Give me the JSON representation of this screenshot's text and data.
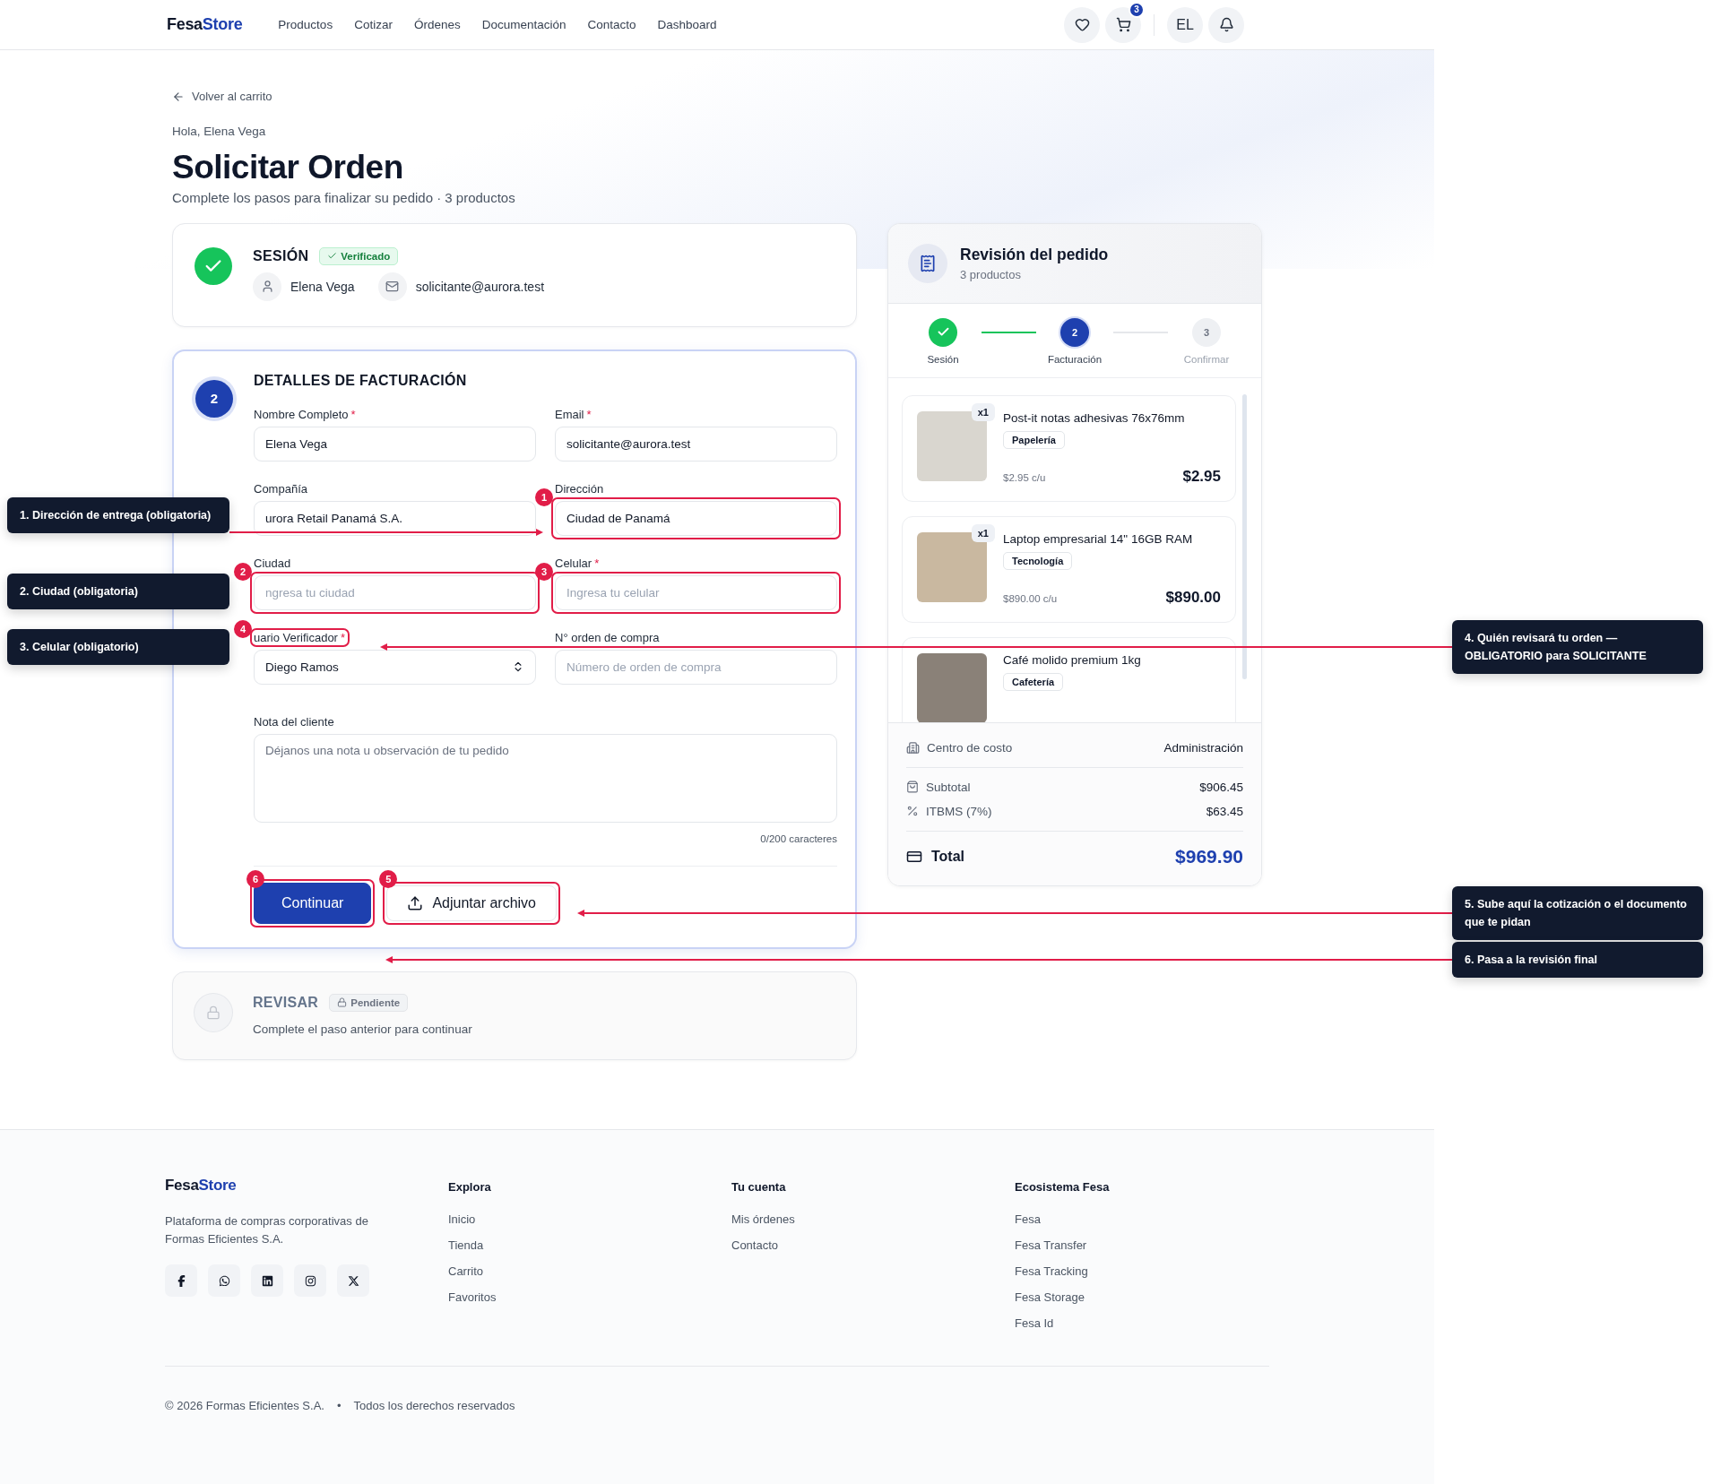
{
  "header": {
    "logo": {
      "part_1": "Fesa",
      "part_2": "Store"
    },
    "nav": [
      "Productos",
      "Cotizar",
      "Órdenes",
      "Documentación",
      "Contacto",
      "Dashboard"
    ],
    "cart_count": "3",
    "avatar": "EL"
  },
  "back_link": "Volver al carrito",
  "greeting": "Hola, Elena Vega",
  "title": "Solicitar Orden",
  "subtitle": "Complete los pasos para finalizar su pedido · 3 productos",
  "steps": [
    {
      "kind": "done",
      "title": "SESIÓN",
      "badge": "Verificado",
      "user": "Elena Vega",
      "email": "solicitante@aurora.test"
    },
    {
      "kind": "active",
      "number": "2",
      "title": "DETALLES DE FACTURACIÓN",
      "fields": [
        {
          "kind": "input",
          "label": "Nombre Completo",
          "required_mark": "*",
          "value": "Elena Vega"
        },
        {
          "kind": "input",
          "label": "Email",
          "required_mark": "*",
          "value": "solicitante@aurora.test"
        },
        {
          "kind": "input",
          "label": "Compañía",
          "value": "urora Retail Panamá S.A."
        },
        {
          "kind": "input",
          "label": "Dirección",
          "value": "Ciudad de Panamá",
          "highlighted": true,
          "tour_badge": "1"
        },
        {
          "kind": "input",
          "label": "Ciudad",
          "placeholder": "ngresa tu ciudad",
          "highlighted": true,
          "tour_badge": "2"
        },
        {
          "kind": "input",
          "label": "Celular",
          "required_mark": "*",
          "placeholder": "Ingresa tu celular",
          "highlighted": true,
          "tour_badge": "3"
        },
        {
          "kind": "select",
          "label": "uario Verificador",
          "required_mark": "*",
          "value": "Diego Ramos",
          "label_highlighted": true,
          "tour_badge": "4"
        },
        {
          "kind": "input",
          "label": "N° orden de compra",
          "placeholder": "Número de orden de compra"
        }
      ],
      "note": {
        "label": "Nota del cliente",
        "placeholder": "Déjanos una nota u observación de tu pedido",
        "counter": "0/200 caracteres"
      },
      "buttons": [
        {
          "kind": "primary",
          "label": "Continuar",
          "tour_badge": "6"
        },
        {
          "kind": "secondary",
          "label": "Adjuntar archivo",
          "tour_badge": "5"
        }
      ]
    },
    {
      "kind": "locked",
      "title": "REVISAR",
      "badge": "Pendiente",
      "message": "Complete el paso anterior para continuar"
    }
  ],
  "summary": {
    "title": "Revisión del pedido",
    "subtitle": "3 productos",
    "stepper": [
      {
        "done": true,
        "selected": false,
        "label": "Sesión"
      },
      {
        "done": false,
        "selected": true,
        "number": "2",
        "label": "Facturación"
      },
      {
        "done": false,
        "selected": false,
        "number": "3",
        "label": "Confirmar"
      }
    ],
    "items": [
      {
        "qty": "x1",
        "name": "Post-it notas adhesivas 76x76mm",
        "category": "Papelería",
        "unit_price": "$2.95 c/u",
        "total": "$2.95"
      },
      {
        "qty": "x1",
        "name": "Laptop empresarial 14\" 16GB RAM",
        "category": "Tecnología",
        "unit_price": "$890.00 c/u",
        "total": "$890.00"
      },
      {
        "name": "Café molido premium 1kg",
        "category": "Cafetería"
      }
    ],
    "cost_center": {
      "label": "Centro de costo",
      "value": "Administración"
    },
    "lines": [
      {
        "kind": "subtotal",
        "label": "Subtotal",
        "value": "$906.45"
      },
      {
        "kind": "tax",
        "label": "ITBMS (7%)",
        "value": "$63.45"
      }
    ],
    "total": {
      "label": "Total",
      "value": "$969.90"
    }
  },
  "tour": [
    {
      "text": "1. Dirección de entrega (obligatoria)"
    },
    {
      "text": "2. Ciudad (obligatoria)"
    },
    {
      "text": "3. Celular (obligatorio)"
    },
    {
      "text": "4. Quién revisará tu orden — OBLIGATORIO para SOLICITANTE"
    },
    {
      "text": "5. Sube aquí la cotización o el documento que te pidan"
    },
    {
      "text": "6. Pasa a la revisión final"
    }
  ],
  "footer": {
    "logo": {
      "part_1": "Fesa",
      "part_2": "Store"
    },
    "tagline": "Plataforma de compras corporativas de Formas Eficientes S.A.",
    "columns": [
      {
        "title": "Explora",
        "links": [
          "Inicio",
          "Tienda",
          "Carrito",
          "Favoritos"
        ]
      },
      {
        "title": "Tu cuenta",
        "links": [
          "Mis órdenes",
          "Contacto"
        ]
      },
      {
        "title": "Ecosistema Fesa",
        "links": [
          "Fesa",
          "Fesa Transfer",
          "Fesa Tracking",
          "Fesa Storage",
          "Fesa Id"
        ]
      }
    ],
    "copyright": "© 2026 Formas Eficientes S.A.",
    "separator": "•",
    "rights": "Todos los derechos reservados"
  }
}
